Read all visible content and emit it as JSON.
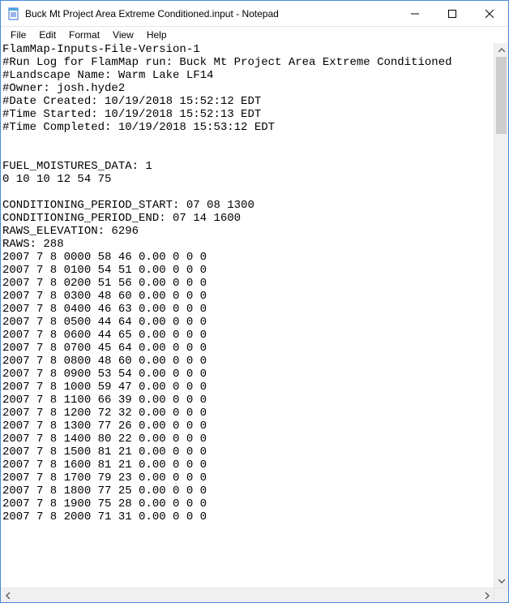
{
  "window": {
    "title": "Buck Mt Project Area Extreme Conditioned.input - Notepad"
  },
  "menu": {
    "file": "File",
    "edit": "Edit",
    "format": "Format",
    "view": "View",
    "help": "Help"
  },
  "document": {
    "header_lines": [
      "FlamMap-Inputs-File-Version-1",
      "#Run Log for FlamMap run: Buck Mt Project Area Extreme Conditioned",
      "#Landscape Name: Warm Lake LF14",
      "#Owner: josh.hyde2",
      "#Date Created: 10/19/2018 15:52:12 EDT",
      "#Time Started: 10/19/2018 15:52:13 EDT",
      "#Time Completed: 10/19/2018 15:53:12 EDT",
      "",
      "",
      "FUEL_MOISTURES_DATA: 1",
      "0 10 10 12 54 75",
      "",
      "CONDITIONING_PERIOD_START: 07 08 1300",
      "CONDITIONING_PERIOD_END: 07 14 1600",
      "RAWS_ELEVATION: 6296",
      "RAWS: 288"
    ],
    "raws_records": [
      {
        "year": 2007,
        "month": 7,
        "day": 8,
        "time": "0000",
        "t": 58,
        "rh": 46,
        "precip": "0.00",
        "ws": 0,
        "wd": 0,
        "cc": 0
      },
      {
        "year": 2007,
        "month": 7,
        "day": 8,
        "time": "0100",
        "t": 54,
        "rh": 51,
        "precip": "0.00",
        "ws": 0,
        "wd": 0,
        "cc": 0
      },
      {
        "year": 2007,
        "month": 7,
        "day": 8,
        "time": "0200",
        "t": 51,
        "rh": 56,
        "precip": "0.00",
        "ws": 0,
        "wd": 0,
        "cc": 0
      },
      {
        "year": 2007,
        "month": 7,
        "day": 8,
        "time": "0300",
        "t": 48,
        "rh": 60,
        "precip": "0.00",
        "ws": 0,
        "wd": 0,
        "cc": 0
      },
      {
        "year": 2007,
        "month": 7,
        "day": 8,
        "time": "0400",
        "t": 46,
        "rh": 63,
        "precip": "0.00",
        "ws": 0,
        "wd": 0,
        "cc": 0
      },
      {
        "year": 2007,
        "month": 7,
        "day": 8,
        "time": "0500",
        "t": 44,
        "rh": 64,
        "precip": "0.00",
        "ws": 0,
        "wd": 0,
        "cc": 0
      },
      {
        "year": 2007,
        "month": 7,
        "day": 8,
        "time": "0600",
        "t": 44,
        "rh": 65,
        "precip": "0.00",
        "ws": 0,
        "wd": 0,
        "cc": 0
      },
      {
        "year": 2007,
        "month": 7,
        "day": 8,
        "time": "0700",
        "t": 45,
        "rh": 64,
        "precip": "0.00",
        "ws": 0,
        "wd": 0,
        "cc": 0
      },
      {
        "year": 2007,
        "month": 7,
        "day": 8,
        "time": "0800",
        "t": 48,
        "rh": 60,
        "precip": "0.00",
        "ws": 0,
        "wd": 0,
        "cc": 0
      },
      {
        "year": 2007,
        "month": 7,
        "day": 8,
        "time": "0900",
        "t": 53,
        "rh": 54,
        "precip": "0.00",
        "ws": 0,
        "wd": 0,
        "cc": 0
      },
      {
        "year": 2007,
        "month": 7,
        "day": 8,
        "time": "1000",
        "t": 59,
        "rh": 47,
        "precip": "0.00",
        "ws": 0,
        "wd": 0,
        "cc": 0
      },
      {
        "year": 2007,
        "month": 7,
        "day": 8,
        "time": "1100",
        "t": 66,
        "rh": 39,
        "precip": "0.00",
        "ws": 0,
        "wd": 0,
        "cc": 0
      },
      {
        "year": 2007,
        "month": 7,
        "day": 8,
        "time": "1200",
        "t": 72,
        "rh": 32,
        "precip": "0.00",
        "ws": 0,
        "wd": 0,
        "cc": 0
      },
      {
        "year": 2007,
        "month": 7,
        "day": 8,
        "time": "1300",
        "t": 77,
        "rh": 26,
        "precip": "0.00",
        "ws": 0,
        "wd": 0,
        "cc": 0
      },
      {
        "year": 2007,
        "month": 7,
        "day": 8,
        "time": "1400",
        "t": 80,
        "rh": 22,
        "precip": "0.00",
        "ws": 0,
        "wd": 0,
        "cc": 0
      },
      {
        "year": 2007,
        "month": 7,
        "day": 8,
        "time": "1500",
        "t": 81,
        "rh": 21,
        "precip": "0.00",
        "ws": 0,
        "wd": 0,
        "cc": 0
      },
      {
        "year": 2007,
        "month": 7,
        "day": 8,
        "time": "1600",
        "t": 81,
        "rh": 21,
        "precip": "0.00",
        "ws": 0,
        "wd": 0,
        "cc": 0
      },
      {
        "year": 2007,
        "month": 7,
        "day": 8,
        "time": "1700",
        "t": 79,
        "rh": 23,
        "precip": "0.00",
        "ws": 0,
        "wd": 0,
        "cc": 0
      },
      {
        "year": 2007,
        "month": 7,
        "day": 8,
        "time": "1800",
        "t": 77,
        "rh": 25,
        "precip": "0.00",
        "ws": 0,
        "wd": 0,
        "cc": 0
      },
      {
        "year": 2007,
        "month": 7,
        "day": 8,
        "time": "1900",
        "t": 75,
        "rh": 28,
        "precip": "0.00",
        "ws": 0,
        "wd": 0,
        "cc": 0
      },
      {
        "year": 2007,
        "month": 7,
        "day": 8,
        "time": "2000",
        "t": 71,
        "rh": 31,
        "precip": "0.00",
        "ws": 0,
        "wd": 0,
        "cc": 0
      }
    ]
  }
}
